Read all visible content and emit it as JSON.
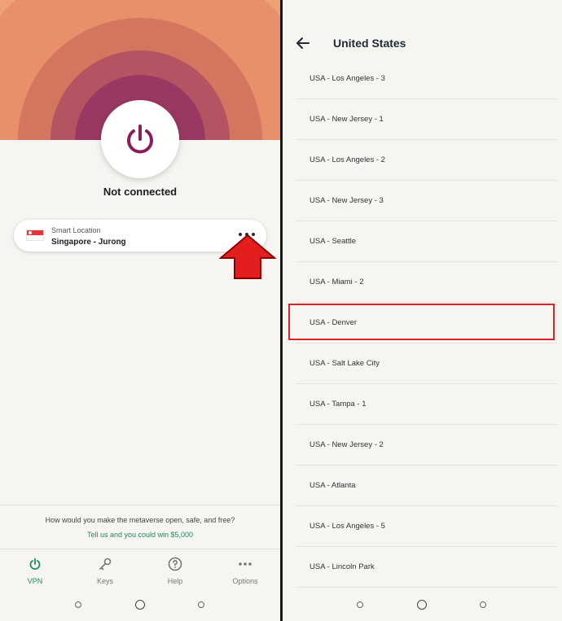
{
  "left": {
    "status": "Not connected",
    "location": {
      "label": "Smart Location",
      "name": "Singapore - Jurong",
      "flag_icon": "singapore-flag-icon"
    },
    "promo": {
      "question": "How would you make the metaverse open, safe, and free?",
      "link": "Tell us and you could win $5,000"
    },
    "nav": [
      {
        "label": "VPN",
        "icon": "power-icon",
        "active": true
      },
      {
        "label": "Keys",
        "icon": "key-icon",
        "active": false
      },
      {
        "label": "Help",
        "icon": "help-icon",
        "active": false
      },
      {
        "label": "Options",
        "icon": "more-icon",
        "active": false
      }
    ],
    "colors": {
      "accent": "#1f8a5f",
      "power": "#8a1e5c",
      "hero": "#f0a070"
    }
  },
  "right": {
    "title": "United States",
    "items": [
      "USA - Los Angeles - 3",
      "USA - New Jersey - 1",
      "USA - Los Angeles - 2",
      "USA - New Jersey - 3",
      "USA - Seattle",
      "USA - Miami - 2",
      "USA - Denver",
      "USA - Salt Lake City",
      "USA - Tampa - 1",
      "USA - New Jersey - 2",
      "USA - Atlanta",
      "USA - Los Angeles - 5",
      "USA - Lincoln Park"
    ],
    "highlighted_item": "USA - Denver",
    "highlight_color": "#d9252a"
  }
}
